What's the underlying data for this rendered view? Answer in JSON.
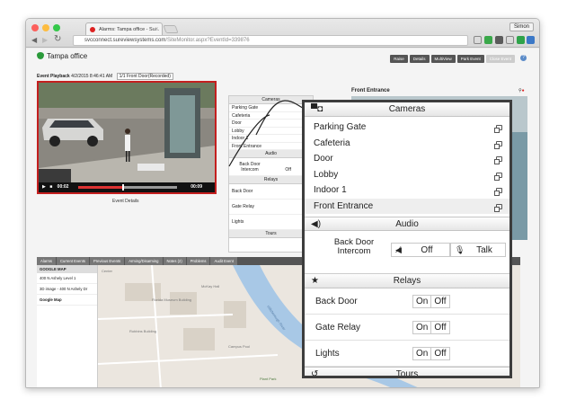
{
  "browser": {
    "tab_title": "Alarms: Tampa office - Su...",
    "user": "Simon",
    "url_host": "svcconnect.sureviewsystems.com",
    "url_path": "/SiteMonitor.aspx?EventId=339876"
  },
  "site": {
    "title": "Tampa office",
    "buttons": [
      "Raise",
      "Details",
      "MultiView",
      "Park Event",
      "Close Event"
    ]
  },
  "playback": {
    "title": "Event Playback",
    "datetime": "4/2/2015 8:46:41 AM",
    "camera_select": "1/1 Front Door(Recorded)",
    "time_current": "00:02",
    "time_end": "00:09",
    "progress": 0.45,
    "event_details": "Event Details"
  },
  "front_entrance": {
    "title": "Front Entrance"
  },
  "small_panel": {
    "cameras_title": "Cameras",
    "cameras": [
      "Parking Gate",
      "Cafeteria",
      "Door",
      "Lobby",
      "Indoor 1",
      "Front Entrance"
    ],
    "audio_title": "Audio",
    "audio_label": "Back Door Intercom",
    "audio_off": "Off",
    "relays_title": "Relays",
    "relays": [
      "Back Door",
      "Gate Relay",
      "Lights"
    ],
    "on": "On",
    "off": "Off",
    "tours_title": "Tours"
  },
  "bottom_tabs": [
    "Alarms",
    "Current Events",
    "Previous Events",
    "Arming/Disarming",
    "Notes (2)",
    "Problems",
    "Audit Event"
  ],
  "google_map": {
    "title": "GOOGLE MAP",
    "items": [
      "400 N Ashely Level 1",
      "3D image - 400 N Ashely Dr",
      "Google Map"
    ],
    "labels": [
      "Center",
      "Tampa Bay History Center",
      "Florida Museum Building",
      "Harbour Island",
      "Hillsborough River",
      "Plant Park",
      "McKay Hall",
      "Campus Pool",
      "Robbins Building"
    ]
  },
  "panel": {
    "cameras_title": "Cameras",
    "cameras": [
      {
        "label": "Parking Gate"
      },
      {
        "label": "Cafeteria"
      },
      {
        "label": "Door"
      },
      {
        "label": "Lobby"
      },
      {
        "label": "Indoor 1"
      },
      {
        "label": "Front Entrance"
      }
    ],
    "audio_title": "Audio",
    "audio_label": "Back Door Intercom",
    "audio_off": "Off",
    "audio_talk": "Talk",
    "relays_title": "Relays",
    "relays": [
      {
        "label": "Back Door",
        "on": "On",
        "off": "Off"
      },
      {
        "label": "Gate Relay",
        "on": "On",
        "off": "Off"
      },
      {
        "label": "Lights",
        "on": "On",
        "off": "Off"
      }
    ],
    "tours_title": "Tours"
  }
}
